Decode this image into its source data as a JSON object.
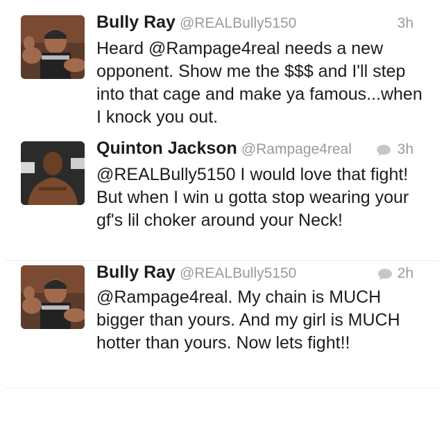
{
  "tweets": [
    {
      "name": "Bully Ray",
      "handle": "@REALBully5150",
      "time": "3h",
      "text": "Heard @Rampage4real needs a new opponent.  Show me the $$$ and I'll step into that cage and make ya famous...when I knock you out.",
      "avatar": "bully-ray-avatar",
      "reply_icon": false
    },
    {
      "name": "Quinton Jackson",
      "handle": "@Rampage4real",
      "time": "3h",
      "text": "@REALBully5150 I would love that fight! But when I win u gotta stop wearing your gf's lil choker around your Neck!",
      "avatar": "quinton-jackson-avatar",
      "reply_icon": true
    },
    {
      "name": "Bully Ray",
      "handle": "@REALBully5150",
      "time": "2h",
      "text": "@Rampage4real.  My chain is MUCH bigger than yours.  And my girl is MUCH hotter than yours.  Now lets fight!!",
      "avatar": "bully-ray-avatar",
      "reply_icon": true
    }
  ],
  "colors": {
    "text": "#1c1c1c",
    "muted": "#9a9a9a",
    "separator": "#e8e8e8"
  }
}
